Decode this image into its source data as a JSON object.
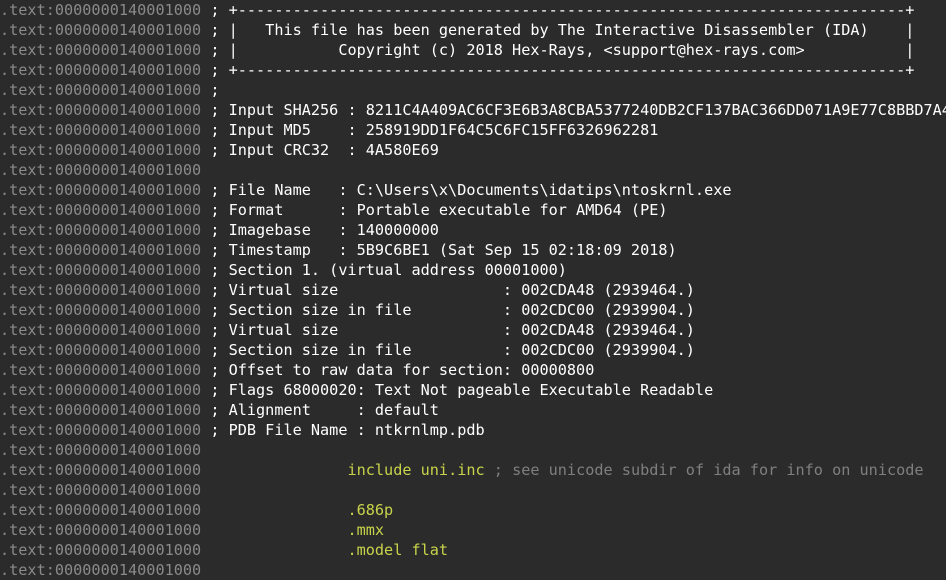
{
  "address": ".text:0000000140001000",
  "lines": [
    {
      "cmt": " ; +-------------------------------------------------------------------------+"
    },
    {
      "cmt": " ; |   This file has been generated by The Interactive Disassembler (IDA)    |"
    },
    {
      "cmt": " ; |           Copyright (c) 2018 Hex-Rays, <support@hex-rays.com>           |"
    },
    {
      "cmt": " ; +-------------------------------------------------------------------------+"
    },
    {
      "cmt": " ;"
    },
    {
      "cmt": " ; Input SHA256 : 8211C4A409AC6CF3E6B3A8CBA5377240DB2CF137BAC366DD071A9E77C8BBD7A4"
    },
    {
      "cmt": " ; Input MD5    : 258919DD1F64C5C6FC15FF6326962281"
    },
    {
      "cmt": " ; Input CRC32  : 4A580E69"
    },
    {
      "cmt": ""
    },
    {
      "cmt": " ; File Name   : C:\\Users\\x\\Documents\\idatips\\ntoskrnl.exe"
    },
    {
      "cmt": " ; Format      : Portable executable for AMD64 (PE)"
    },
    {
      "cmt": " ; Imagebase   : 140000000"
    },
    {
      "cmt": " ; Timestamp   : 5B9C6BE1 (Sat Sep 15 02:18:09 2018)"
    },
    {
      "cmt": " ; Section 1. (virtual address 00001000)"
    },
    {
      "cmt": " ; Virtual size                  : 002CDA48 (2939464.)"
    },
    {
      "cmt": " ; Section size in file          : 002CDC00 (2939904.)"
    },
    {
      "cmt": " ; Virtual size                  : 002CDA48 (2939464.)"
    },
    {
      "cmt": " ; Section size in file          : 002CDC00 (2939904.)"
    },
    {
      "cmt": " ; Offset to raw data for section: 00000800"
    },
    {
      "cmt": " ; Flags 68000020: Text Not pageable Executable Readable"
    },
    {
      "cmt": " ; Alignment     : default"
    },
    {
      "cmt": " ; PDB File Name : ntkrnlmp.pdb"
    },
    {
      "cmt": ""
    },
    {
      "pad": "                ",
      "dir": "include uni.inc",
      "rcmt": " ; see unicode subdir of ida for info on unicode"
    },
    {
      "cmt": ""
    },
    {
      "pad": "                ",
      "dir": ".686p"
    },
    {
      "pad": "                ",
      "dir": ".mmx"
    },
    {
      "pad": "                ",
      "dir": ".model flat"
    },
    {
      "cmt": ""
    }
  ],
  "colors": {
    "background": "#2b2b2b",
    "address": "#8a8a8a",
    "comment": "#ffffff",
    "directive": "#c8d34a",
    "repeatable_comment": "#7f7f7f"
  }
}
